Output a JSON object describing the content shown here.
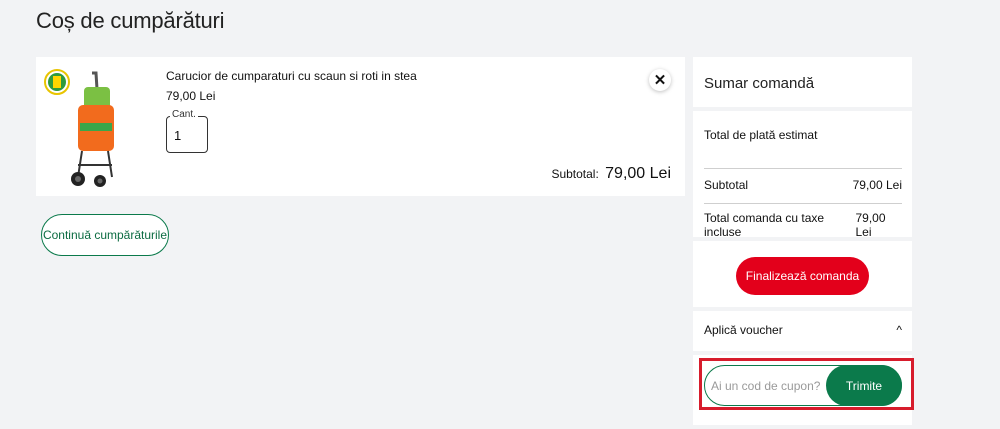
{
  "page": {
    "title": "Coș de cumpărături"
  },
  "cart": {
    "item": {
      "name": "Carucior de cumparaturi cu scaun si roti in stea",
      "price": "79,00 Lei",
      "qty_label": "Cant.",
      "qty_value": "1",
      "remove_icon": "close-icon",
      "subtotal_label": "Subtotal:",
      "subtotal_value": "79,00 Lei"
    },
    "continue_label": "Continuă cumpărăturile"
  },
  "summary": {
    "title": "Sumar comandă",
    "estimated_label": "Total de plată estimat",
    "rows": [
      {
        "label": "Subtotal",
        "value": "79,00 Lei"
      },
      {
        "label": "Total comanda cu taxe incluse",
        "value": "79,00 Lei"
      }
    ],
    "checkout_label": "Finalizează comanda",
    "voucher_label": "Aplică voucher",
    "voucher_icon": "chevron-up-icon",
    "coupon_placeholder": "Ai un cod de cupon?",
    "send_label": "Trimite"
  },
  "colors": {
    "accent_green": "#0b7a4b",
    "cta_red": "#e3001b",
    "highlight_red": "#d71c2c",
    "background": "#f2f3f5"
  }
}
